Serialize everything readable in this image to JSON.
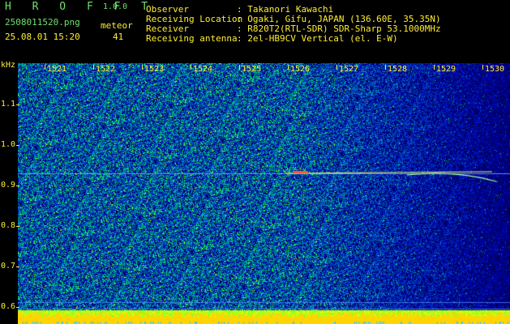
{
  "app": {
    "name": "H R O F F T",
    "version": "1.0.0"
  },
  "file": {
    "name": "2508011520.png",
    "datetime": "25.08.01 15:20"
  },
  "mode": {
    "label": "meteor",
    "count": "41"
  },
  "info": [
    {
      "label": "Observer",
      "value": ": Takanori Kawachi"
    },
    {
      "label": "Receiving Location",
      "value": ": Ogaki, Gifu, JAPAN (136.60E, 35.35N)"
    },
    {
      "label": "Receiver",
      "value": ": R820T2(RTL-SDR) SDR-Sharp 53.1000MHz"
    },
    {
      "label": "Receiving antenna",
      "value": ": 2el-HB9CV Vertical (el. E-W)"
    }
  ],
  "y_axis": {
    "unit": "kHz",
    "ticks": [
      "1.1",
      "1.0",
      "0.9",
      "0.8",
      "0.7",
      "0.6"
    ]
  },
  "x_axis": {
    "ticks": [
      "1521",
      "1522",
      "1523",
      "1524",
      "1525",
      "1526",
      "1527",
      "1528",
      "1529",
      "1530"
    ]
  },
  "colors": {
    "label": "#ffee33",
    "title": "#6fe06f",
    "text": "#ffffff",
    "noise_bg": "#0b1a8c"
  }
}
